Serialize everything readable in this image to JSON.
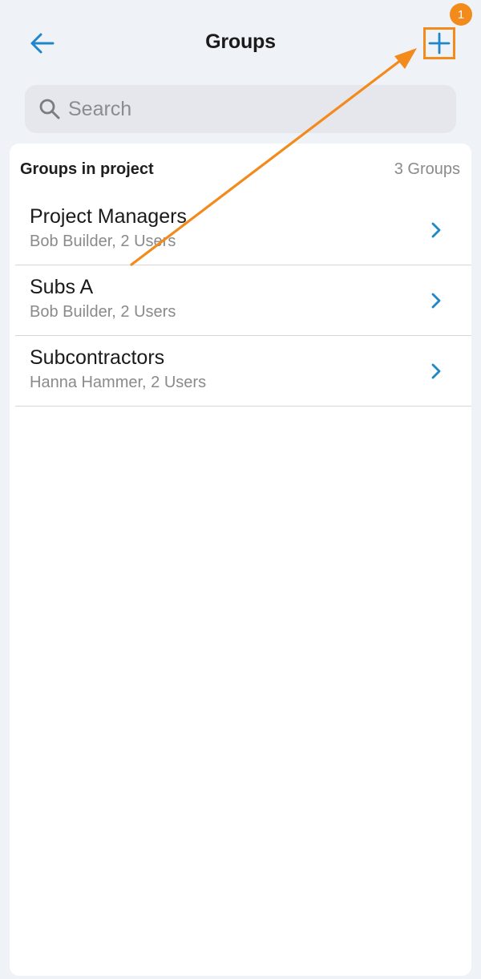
{
  "header": {
    "title": "Groups",
    "back_icon": "arrow-left-icon",
    "add_icon": "plus-icon",
    "step_badge": "1"
  },
  "search": {
    "placeholder": "Search",
    "icon": "search-icon"
  },
  "section": {
    "title": "Groups in project",
    "count": "3 Groups"
  },
  "groups": [
    {
      "name": "Project Managers",
      "detail": "Bob Builder, 2 Users"
    },
    {
      "name": "Subs A",
      "detail": "Bob Builder, 2 Users"
    },
    {
      "name": "Subcontractors",
      "detail": "Hanna Hammer, 2 Users"
    }
  ],
  "colors": {
    "accent": "#1f87c7",
    "annotation": "#f28a1c",
    "background": "#eff2f6",
    "card": "#ffffff"
  }
}
